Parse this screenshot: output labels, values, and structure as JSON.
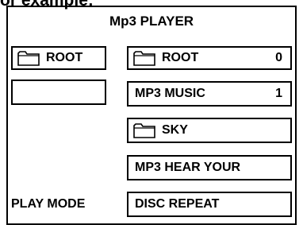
{
  "caption": "or example:",
  "title": "Mp3  PLAYER",
  "left_panel": {
    "folder_label": "ROOT",
    "play_mode_label": "PLAY MODE"
  },
  "right_panel": {
    "rows": [
      {
        "label": "ROOT",
        "icon": "folder-icon",
        "count": "0"
      },
      {
        "label": "MP3 MUSIC",
        "count": "1"
      },
      {
        "label": "SKY",
        "icon": "folder-icon"
      },
      {
        "label": "MP3 HEAR YOUR"
      },
      {
        "label": "DISC REPEAT"
      }
    ]
  }
}
